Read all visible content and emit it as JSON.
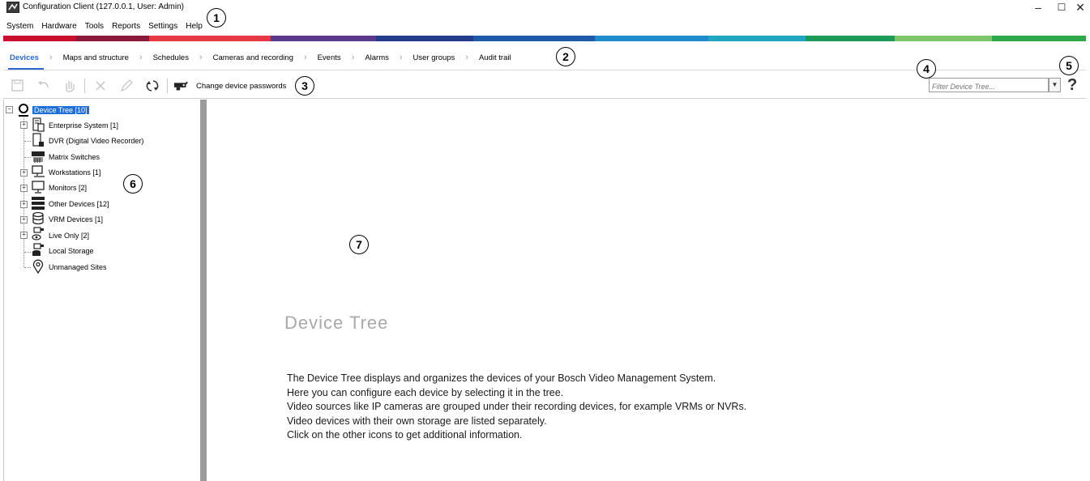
{
  "window": {
    "title": "Configuration Client (127.0.0.1, User: Admin)",
    "minimize_glyph": "–",
    "maximize_glyph": "☐",
    "close_glyph": "✕"
  },
  "menu": [
    "System",
    "Hardware",
    "Tools",
    "Reports",
    "Settings",
    "Help"
  ],
  "color_strip": [
    "#c8102e",
    "#8b1a3a",
    "#e63946",
    "#5b3a8e",
    "#243c8c",
    "#1f5aa8",
    "#1e8bcb",
    "#1fa7c0",
    "#1c9b5a",
    "#7ec468",
    "#2ea84a"
  ],
  "tabs": [
    {
      "label": "Devices",
      "active": true
    },
    {
      "label": "Maps and structure"
    },
    {
      "label": "Schedules"
    },
    {
      "label": "Cameras and recording"
    },
    {
      "label": "Events"
    },
    {
      "label": "Alarms"
    },
    {
      "label": "User groups"
    },
    {
      "label": "Audit trail"
    }
  ],
  "tab_separator": "›",
  "toolbar": {
    "change_passwords_label": "Change device passwords",
    "filter_placeholder": "Filter Device Tree...",
    "help_glyph": "?"
  },
  "tree": {
    "root": "Device Tree [10]",
    "items": [
      {
        "label": "Enterprise System [1]",
        "icon": "enterprise-system-icon",
        "expandable": true
      },
      {
        "label": "DVR (Digital Video Recorder)",
        "icon": "dvr-icon",
        "expandable": false
      },
      {
        "label": "Matrix Switches",
        "icon": "matrix-switch-icon",
        "expandable": false
      },
      {
        "label": "Workstations [1]",
        "icon": "workstation-icon",
        "expandable": true
      },
      {
        "label": "Monitors [2]",
        "icon": "monitor-icon",
        "expandable": true
      },
      {
        "label": "Other Devices [12]",
        "icon": "other-devices-icon",
        "expandable": true
      },
      {
        "label": "VRM Devices [1]",
        "icon": "vrm-icon",
        "expandable": true
      },
      {
        "label": "Live Only [2]",
        "icon": "live-only-icon",
        "expandable": true
      },
      {
        "label": "Local Storage",
        "icon": "local-storage-icon",
        "expandable": false
      },
      {
        "label": "Unmanaged Sites",
        "icon": "unmanaged-sites-icon",
        "expandable": false
      }
    ]
  },
  "callouts": [
    "1",
    "2",
    "3",
    "4",
    "5",
    "6",
    "7"
  ],
  "content": {
    "heading": "Device Tree",
    "lines": [
      "The Device Tree displays and organizes the devices of your Bosch Video Management System.",
      "Here you can configure each device by selecting it in the tree.",
      "Video sources like IP cameras are grouped under their recording devices, for example VRMs or NVRs.",
      "Video devices with their own storage are listed separately.",
      "Click on the other icons to get additional information."
    ]
  }
}
